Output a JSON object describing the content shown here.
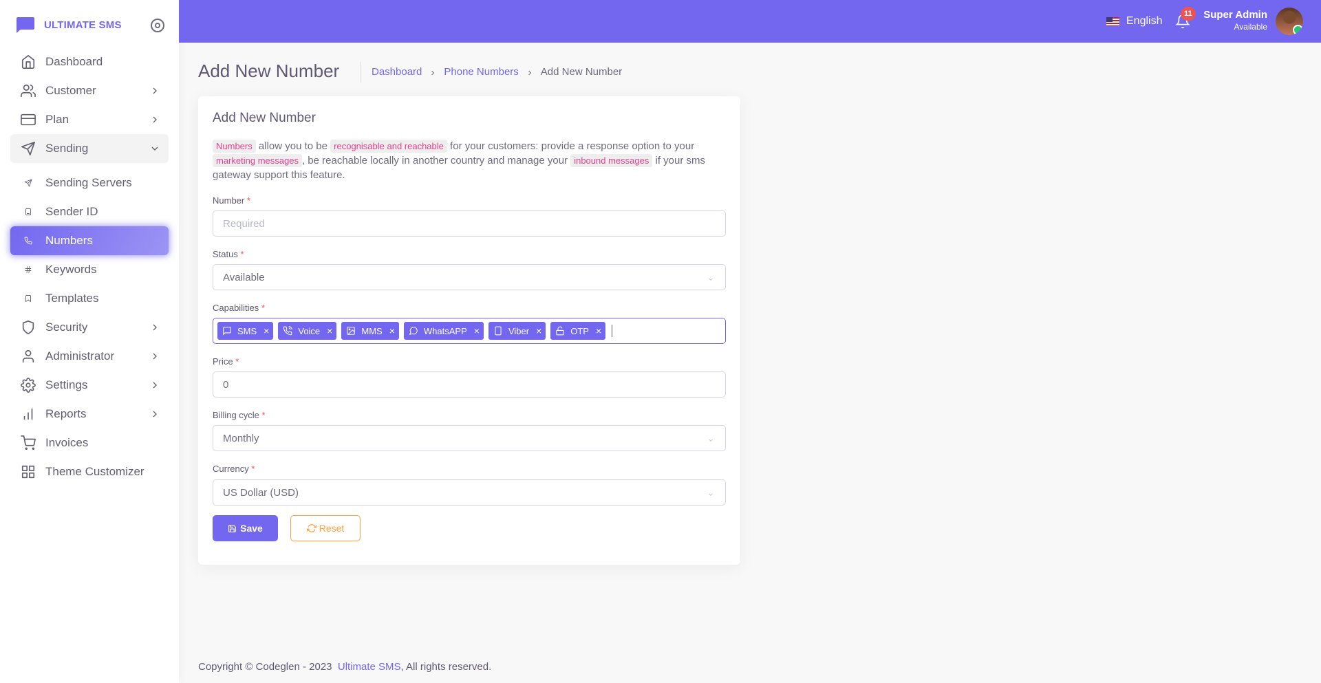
{
  "brand": {
    "name": "ULTIMATE SMS"
  },
  "sidebar": {
    "items": [
      {
        "label": "Dashboard",
        "icon": "home-icon"
      },
      {
        "label": "Customer",
        "icon": "users-icon",
        "chevron": true
      },
      {
        "label": "Plan",
        "icon": "credit-card-icon",
        "chevron": true
      },
      {
        "label": "Sending",
        "icon": "send-icon",
        "chevron": true,
        "open": true
      },
      {
        "label": "Sending Servers",
        "icon": "send-icon",
        "sub": true
      },
      {
        "label": "Sender ID",
        "icon": "book-icon",
        "sub": true
      },
      {
        "label": "Numbers",
        "icon": "phone-icon",
        "sub": true,
        "active": true
      },
      {
        "label": "Keywords",
        "icon": "hash-icon",
        "sub": true
      },
      {
        "label": "Templates",
        "icon": "bookmark-icon",
        "sub": true
      },
      {
        "label": "Security",
        "icon": "shield-icon",
        "chevron": true
      },
      {
        "label": "Administrator",
        "icon": "user-icon",
        "chevron": true
      },
      {
        "label": "Settings",
        "icon": "gear-icon",
        "chevron": true
      },
      {
        "label": "Reports",
        "icon": "bar-chart-icon",
        "chevron": true
      },
      {
        "label": "Invoices",
        "icon": "cart-icon"
      },
      {
        "label": "Theme Customizer",
        "icon": "grid-icon"
      }
    ]
  },
  "header": {
    "language": "English",
    "notification_count": "11",
    "user_name": "Super Admin",
    "user_status": "Available"
  },
  "page": {
    "title": "Add New Number",
    "breadcrumb": [
      "Dashboard",
      "Phone Numbers",
      "Add New Number"
    ]
  },
  "form": {
    "card_title": "Add New Number",
    "intro": {
      "tag1": "Numbers",
      "text1": " allow you to be ",
      "tag2": "recognisable and reachable",
      "text2": " for your customers: provide a response option to your ",
      "tag3": "marketing messages",
      "text3": ", be reachable locally in another country and manage your ",
      "tag4": "inbound messages",
      "text4": " if your sms gateway support this feature."
    },
    "number": {
      "label": "Number",
      "required": "*",
      "placeholder": "Required"
    },
    "status": {
      "label": "Status",
      "required": "*",
      "value": "Available"
    },
    "capabilities": {
      "label": "Capabilities",
      "required": "*",
      "tags": [
        {
          "label": "SMS",
          "icon": "message-square-icon"
        },
        {
          "label": "Voice",
          "icon": "phone-call-icon"
        },
        {
          "label": "MMS",
          "icon": "image-icon"
        },
        {
          "label": "WhatsAPP",
          "icon": "message-circle-icon"
        },
        {
          "label": "Viber",
          "icon": "smartphone-icon"
        },
        {
          "label": "OTP",
          "icon": "unlock-icon"
        }
      ],
      "remove_glyph": "×"
    },
    "price": {
      "label": "Price",
      "required": "*",
      "value": "0"
    },
    "billing_cycle": {
      "label": "Billing cycle",
      "required": "*",
      "value": "Monthly"
    },
    "currency": {
      "label": "Currency",
      "required": "*",
      "value": "US Dollar (USD)"
    },
    "save_label": "Save",
    "reset_label": "Reset"
  },
  "footer": {
    "text": "Copyright © Codeglen - 2023",
    "link": "Ultimate SMS",
    "suffix": ", All rights reserved."
  },
  "colors": {
    "primary": "#7367f0",
    "danger": "#ea5455",
    "warning": "#ff9f43",
    "code_pink": "#e83e8c"
  }
}
